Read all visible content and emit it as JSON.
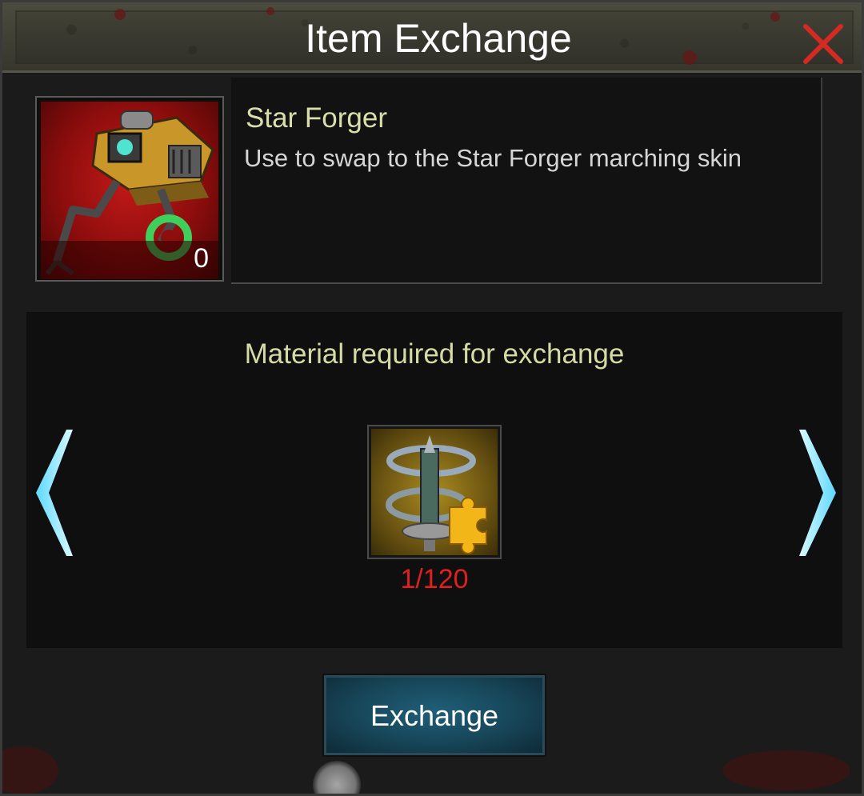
{
  "dialog": {
    "title": "Item Exchange",
    "close_icon": "close-icon"
  },
  "item": {
    "name": "Star Forger",
    "description": "Use to swap to the Star Forger marching skin",
    "count": "0",
    "icon": "mech-walker-icon"
  },
  "material": {
    "heading": "Material required for exchange",
    "count": "1/120",
    "icon": "tower-puzzle-piece-icon",
    "count_color": "#e01f1f"
  },
  "navigation": {
    "prev_icon": "chevron-left-icon",
    "next_icon": "chevron-right-icon"
  },
  "actions": {
    "exchange_label": "Exchange"
  },
  "colors": {
    "accent_text": "#d9deaa",
    "close_red": "#d42a22",
    "arrow_cyan": "#8fe8ff",
    "button_teal": "#1f5f78"
  }
}
